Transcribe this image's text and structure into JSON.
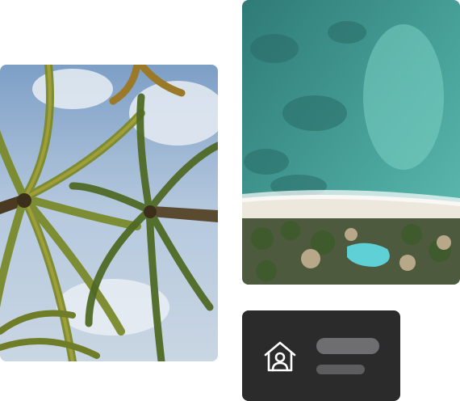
{
  "images": [
    {
      "name": "palm-trees-photo",
      "description": ""
    },
    {
      "name": "beach-aerial-photo",
      "description": ""
    }
  ],
  "card": {
    "icon": "home-person-icon",
    "placeholders": [
      "title-placeholder",
      "subtitle-placeholder"
    ]
  },
  "colors": {
    "card_background": "#2b2b2c",
    "placeholder_bar": "#6e6e70",
    "icon_stroke": "#ffffff",
    "sky": "#9ab7d6",
    "sea": "#3f9a94"
  }
}
